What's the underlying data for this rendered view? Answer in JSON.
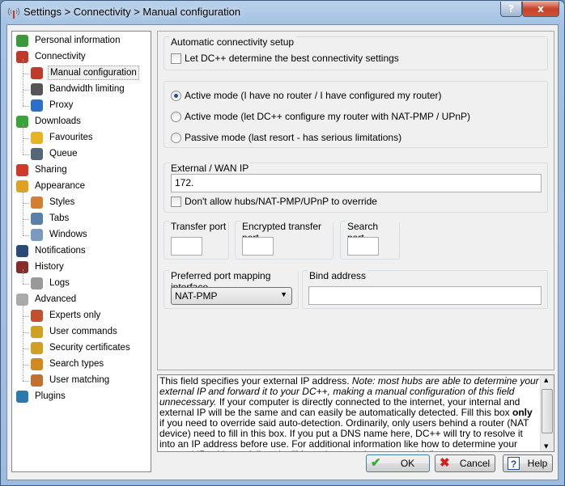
{
  "window": {
    "title": "Settings > Connectivity > Manual configuration",
    "help_btn": "?",
    "close_btn": "x"
  },
  "tree": [
    {
      "label": "Personal information",
      "level": 0,
      "icon": "user-icon",
      "color": "#3a9a3a"
    },
    {
      "label": "Connectivity",
      "level": 0,
      "icon": "antenna-icon",
      "color": "#c0392b"
    },
    {
      "label": "Manual configuration",
      "level": 1,
      "icon": "antenna-icon",
      "color": "#c0392b",
      "selected": true
    },
    {
      "label": "Bandwidth limiting",
      "level": 1,
      "icon": "gauge-icon",
      "color": "#555555"
    },
    {
      "label": "Proxy",
      "level": 1,
      "icon": "globe-icon",
      "color": "#2a6fc9"
    },
    {
      "label": "Downloads",
      "level": 0,
      "icon": "down-arrow-icon",
      "color": "#3aa33a"
    },
    {
      "label": "Favourites",
      "level": 1,
      "icon": "folder-star-icon",
      "color": "#e6b422"
    },
    {
      "label": "Queue",
      "level": 1,
      "icon": "queue-icon",
      "color": "#556677"
    },
    {
      "label": "Sharing",
      "level": 0,
      "icon": "up-arrow-icon",
      "color": "#d03a2a"
    },
    {
      "label": "Appearance",
      "level": 0,
      "icon": "palette-icon",
      "color": "#e0a020"
    },
    {
      "label": "Styles",
      "level": 1,
      "icon": "brush-icon",
      "color": "#d08030"
    },
    {
      "label": "Tabs",
      "level": 1,
      "icon": "tabs-icon",
      "color": "#5a7fa8"
    },
    {
      "label": "Windows",
      "level": 1,
      "icon": "window-icon",
      "color": "#7a9ac0"
    },
    {
      "label": "Notifications",
      "level": 0,
      "icon": "bell-icon",
      "color": "#2a4a7a"
    },
    {
      "label": "History",
      "level": 0,
      "icon": "clock-icon",
      "color": "#8a2a2a"
    },
    {
      "label": "Logs",
      "level": 1,
      "icon": "log-icon",
      "color": "#999999"
    },
    {
      "label": "Advanced",
      "level": 0,
      "icon": "gear-icon",
      "color": "#aaaaaa"
    },
    {
      "label": "Experts only",
      "level": 1,
      "icon": "tools-icon",
      "color": "#c05030"
    },
    {
      "label": "User commands",
      "level": 1,
      "icon": "key-icon",
      "color": "#d0a020"
    },
    {
      "label": "Security certificates",
      "level": 1,
      "icon": "lock-icon",
      "color": "#d0a020"
    },
    {
      "label": "Search types",
      "level": 1,
      "icon": "magnifier-icon",
      "color": "#d08a20"
    },
    {
      "label": "User matching",
      "level": 1,
      "icon": "users-icon",
      "color": "#c07030"
    },
    {
      "label": "Plugins",
      "level": 0,
      "icon": "plugin-icon",
      "color": "#2a7ab0"
    }
  ],
  "auto": {
    "group": "Automatic connectivity setup",
    "checkbox": "Let DC++ determine the best connectivity settings",
    "checked": false
  },
  "modes": [
    {
      "label": "Active mode (I have no router / I have configured my router)",
      "selected": true
    },
    {
      "label": "Active mode (let DC++ configure my router with NAT-PMP / UPnP)",
      "selected": false
    },
    {
      "label": "Passive mode (last resort - has serious limitations)",
      "selected": false
    }
  ],
  "wan": {
    "group": "External / WAN IP",
    "value": "172.",
    "checkbox": "Don't allow hubs/NAT-PMP/UPnP to override",
    "checked": false
  },
  "ports": {
    "transfer": "Transfer port",
    "encrypted": "Encrypted transfer port",
    "search": "Search port",
    "transfer_value": "",
    "encrypted_value": "",
    "search_value": ""
  },
  "mapping": {
    "group": "Preferred port mapping interface",
    "selected": "NAT-PMP"
  },
  "bind": {
    "group": "Bind address",
    "value": ""
  },
  "help": {
    "p1": "This field specifies your external IP address. ",
    "note": "Note: most hubs are able to determine your external IP and forward it to your DC++, making a manual configuration of this field unnecessary.",
    "p2": " If your computer is directly connected to the internet, your internal and external IP will be the same and can easily be automatically detected. Fill this box ",
    "bold": "only",
    "p3": " if you need to override said auto-detection. Ordinarily, only users behind a router (NAT device) need to fill in this box. If you put a DNS name here, DC++ will try to resolve it into an IP address before use. For additional information like how to determine your external IP address, follow the \"Manual connection setup guide\"."
  },
  "buttons": {
    "ok": "OK",
    "cancel": "Cancel",
    "help": "Help",
    "ok_icon": "✔",
    "cancel_icon": "✖",
    "help_icon": "?"
  }
}
